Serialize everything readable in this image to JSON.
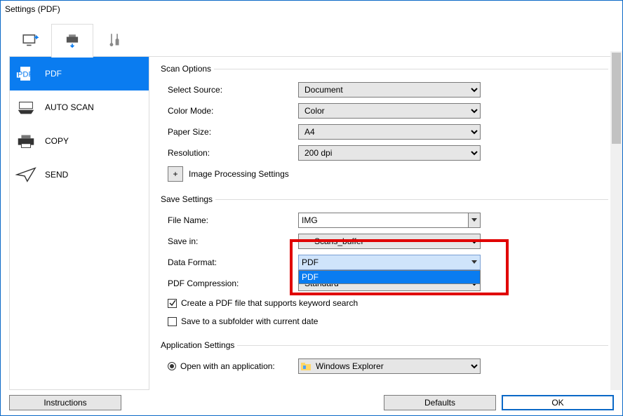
{
  "title": "Settings (PDF)",
  "sidebar": {
    "items": [
      {
        "label": "PDF"
      },
      {
        "label": "AUTO SCAN"
      },
      {
        "label": "COPY"
      },
      {
        "label": "SEND"
      }
    ]
  },
  "scan_options": {
    "legend": "Scan Options",
    "select_source_label": "Select Source:",
    "select_source_value": "Document",
    "color_mode_label": "Color Mode:",
    "color_mode_value": "Color",
    "paper_size_label": "Paper Size:",
    "paper_size_value": "A4",
    "resolution_label": "Resolution:",
    "resolution_value": "200 dpi",
    "image_processing_label": "Image Processing Settings"
  },
  "save_settings": {
    "legend": "Save Settings",
    "file_name_label": "File Name:",
    "file_name_value": "IMG",
    "save_in_label": "Save in:",
    "save_in_value": "Scans_buffer",
    "data_format_label": "Data Format:",
    "data_format_value": "PDF",
    "data_format_option": "PDF",
    "pdf_compression_label": "PDF Compression:",
    "pdf_compression_value": "Standard",
    "create_pdf_keyword_label": "Create a PDF file that supports keyword search",
    "save_subfolder_label": "Save to a subfolder with current date"
  },
  "application_settings": {
    "legend": "Application Settings",
    "open_with_label": "Open with an application:",
    "open_with_value": "Windows Explorer"
  },
  "footer": {
    "instructions": "Instructions",
    "defaults": "Defaults",
    "ok": "OK"
  }
}
